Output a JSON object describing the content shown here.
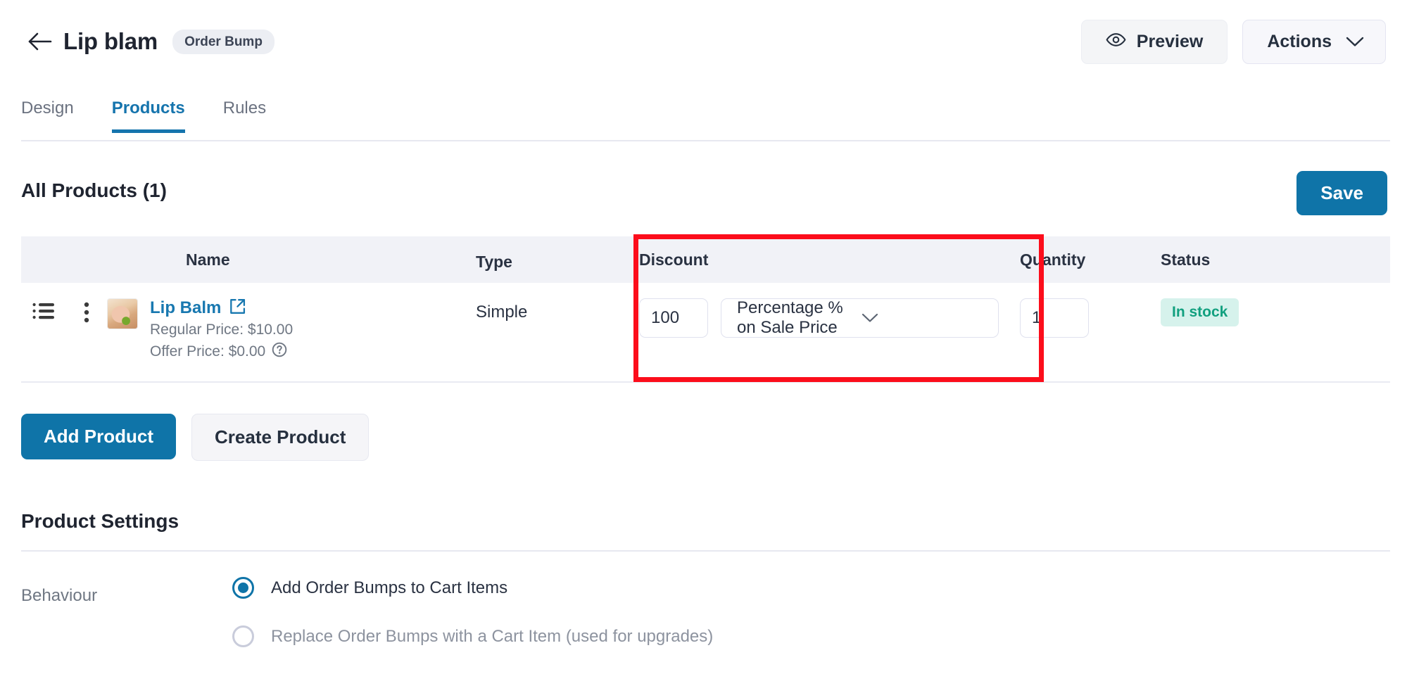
{
  "header": {
    "back_icon": "arrow-left-icon",
    "title": "Lip blam",
    "badge": "Order Bump",
    "preview_label": "Preview",
    "preview_icon": "eye-icon",
    "actions_label": "Actions",
    "actions_icon": "chevron-down-icon"
  },
  "tabs": [
    {
      "label": "Design",
      "active": false
    },
    {
      "label": "Products",
      "active": true
    },
    {
      "label": "Rules",
      "active": false
    }
  ],
  "products_section": {
    "heading": "All Products (1)",
    "save_label": "Save",
    "columns": {
      "name": "Name",
      "type": "Type",
      "discount": "Discount",
      "quantity": "Quantity",
      "status": "Status"
    },
    "rows": [
      {
        "drag_icon": "list-reorder-icon",
        "menu_icon": "more-vertical-icon",
        "thumbnail": "product-thumbnail-lip-balm",
        "name": "Lip Balm",
        "external_icon": "external-link-icon",
        "regular_price": "Regular Price: $10.00",
        "offer_price": "Offer Price: $0.00",
        "help_icon": "help-circle-icon",
        "type": "Simple",
        "discount_value": "100",
        "discount_type": "Percentage % on Sale Price",
        "quantity": "1",
        "status": "In stock"
      }
    ],
    "add_product_label": "Add Product",
    "create_product_label": "Create Product"
  },
  "product_settings": {
    "heading": "Product Settings",
    "behaviour_label": "Behaviour",
    "options": [
      {
        "label": "Add Order Bumps to Cart Items",
        "selected": true
      },
      {
        "label": "Replace Order Bumps with a Cart Item (used for upgrades)",
        "selected": false
      }
    ]
  },
  "annotation": {
    "highlight_color": "#fc0d1b",
    "target": "discount-column"
  },
  "colors": {
    "primary": "#0f74a8",
    "tab_active": "#1574ad",
    "link": "#1878b0",
    "status_text": "#11a07f",
    "status_bg": "#d6f2ec"
  }
}
